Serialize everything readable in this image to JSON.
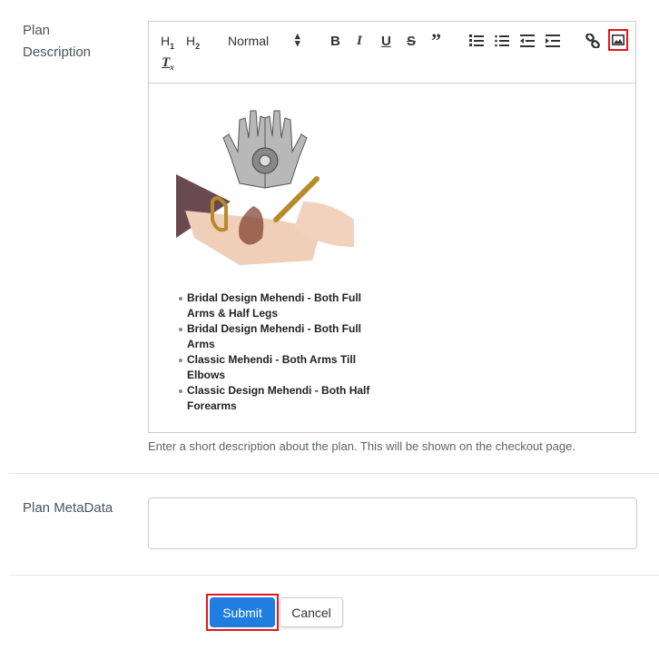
{
  "description_field": {
    "label_line1": "Plan",
    "label_line2": "Description",
    "toolbar": {
      "h1": "H1",
      "h2": "H2",
      "format_select": "Normal",
      "bold": "B",
      "italic": "I",
      "underline": "U",
      "strike": "S",
      "quote": "❞",
      "clear_format": "Tx"
    },
    "content": {
      "image_alt": "Mehendi henna hands illustration",
      "bullets": [
        "Bridal Design Mehendi - Both Full Arms & Half Legs",
        "Bridal Design Mehendi - Both Full Arms",
        "Classic Mehendi - Both Arms Till Elbows",
        "Classic Design Mehendi - Both Half Forearms"
      ]
    },
    "help_text": "Enter a short description about the plan. This will be shown on the checkout page."
  },
  "metadata_field": {
    "label": "Plan MetaData",
    "value": ""
  },
  "actions": {
    "submit": "Submit",
    "cancel": "Cancel"
  },
  "colors": {
    "primary": "#1f7ee0",
    "highlight": "#e3171c"
  }
}
